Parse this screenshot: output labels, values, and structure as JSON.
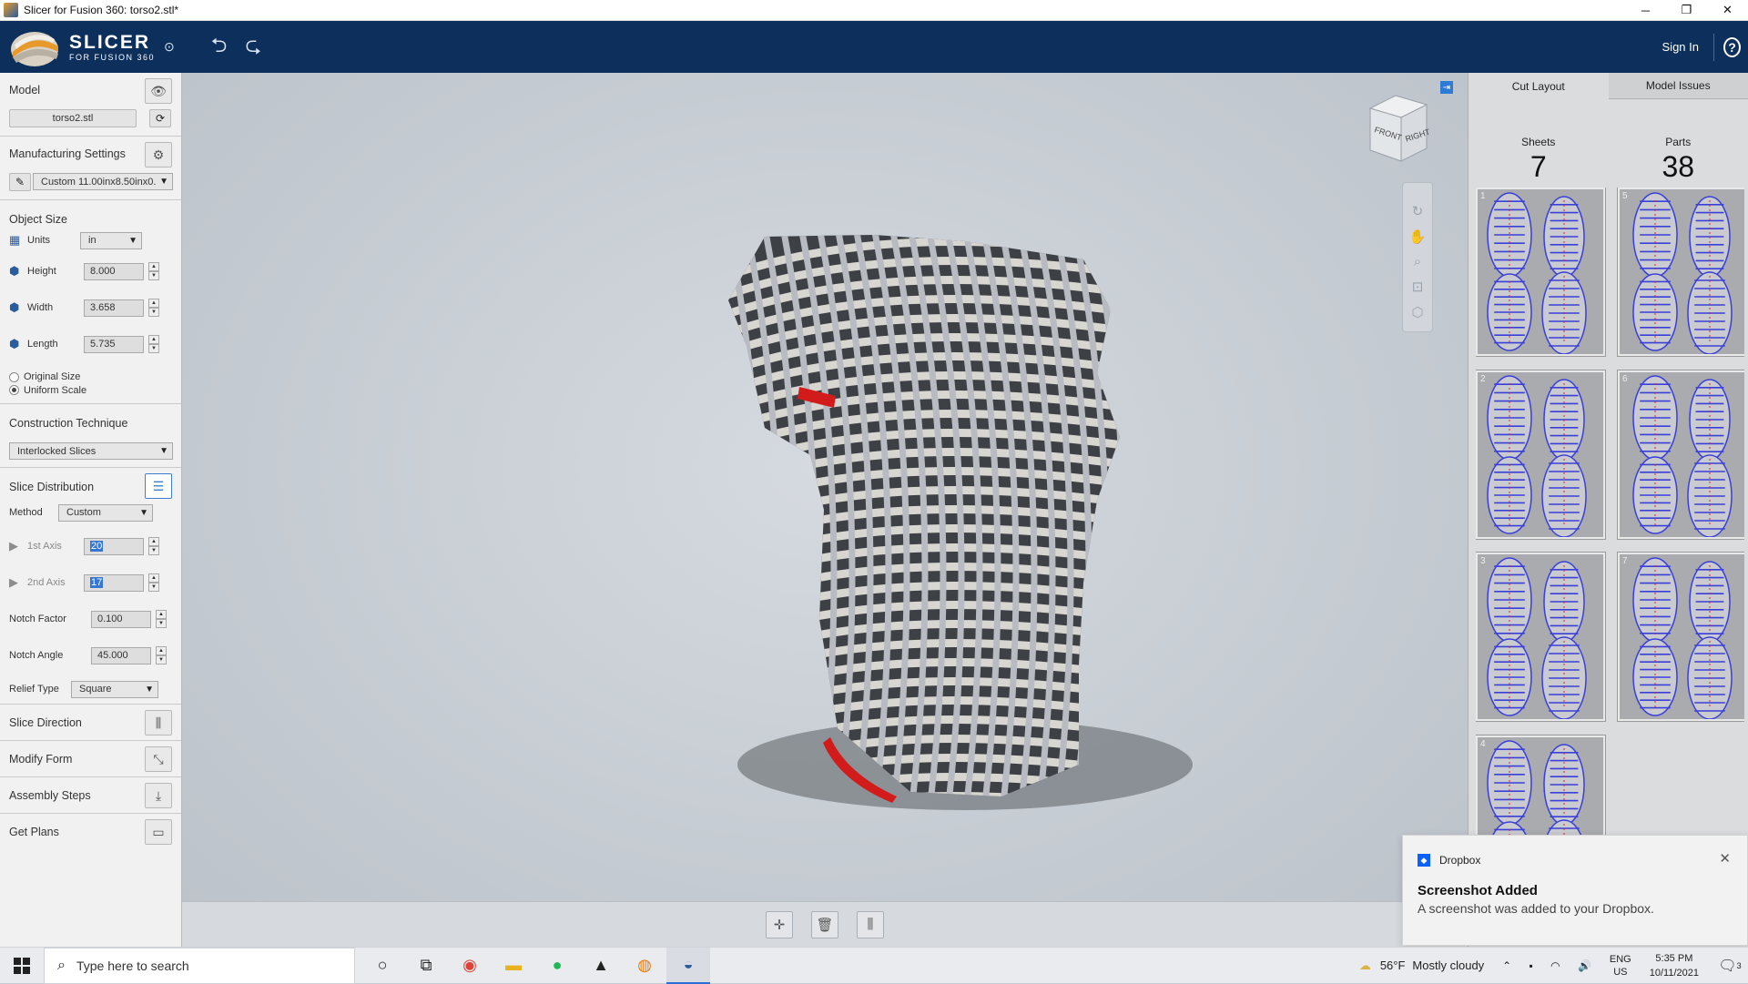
{
  "window": {
    "title": "Slicer for Fusion 360: torso2.stl*",
    "minimize": "─",
    "maximize": "❐",
    "close": "✕"
  },
  "header": {
    "logo_main": "SLICER",
    "logo_sub": "FOR FUSION 360",
    "sign_in": "Sign In",
    "help": "?"
  },
  "model": {
    "title": "Model",
    "file": "torso2.stl"
  },
  "manufacturing": {
    "title": "Manufacturing Settings",
    "preset": "Custom 11.00inx8.50inx0."
  },
  "object_size": {
    "title": "Object Size",
    "units_label": "Units",
    "units_value": "in",
    "height_label": "Height",
    "height_value": "8.000",
    "width_label": "Width",
    "width_value": "3.658",
    "length_label": "Length",
    "length_value": "5.735",
    "original_size": "Original Size",
    "uniform_scale": "Uniform Scale"
  },
  "construction": {
    "title": "Construction Technique",
    "value": "Interlocked Slices"
  },
  "slice_distribution": {
    "title": "Slice Distribution",
    "method_label": "Method",
    "method_value": "Custom",
    "axis1_label": "1st Axis",
    "axis1_value": "20",
    "axis2_label": "2nd Axis",
    "axis2_value": "17",
    "notch_factor_label": "Notch Factor",
    "notch_factor_value": "0.100",
    "notch_angle_label": "Notch Angle",
    "notch_angle_value": "45.000",
    "relief_label": "Relief Type",
    "relief_value": "Square"
  },
  "sections": {
    "slice_direction": "Slice Direction",
    "modify_form": "Modify Form",
    "assembly_steps": "Assembly Steps",
    "get_plans": "Get Plans"
  },
  "view_cube": {
    "front": "FRONT",
    "right": "RIGHT"
  },
  "right_panel": {
    "tab_cut_layout": "Cut Layout",
    "tab_model_issues": "Model Issues",
    "sheets_label": "Sheets",
    "sheets_value": "7",
    "parts_label": "Parts",
    "parts_value": "38",
    "sheet_numbers": [
      "1",
      "5",
      "2",
      "6",
      "3",
      "7",
      "4"
    ]
  },
  "toast": {
    "app": "Dropbox",
    "title": "Screenshot Added",
    "body": "A screenshot was added to your Dropbox."
  },
  "taskbar": {
    "search_placeholder": "Type here to search",
    "temperature": "56°F",
    "weather": "Mostly cloudy",
    "lang1": "ENG",
    "lang2": "US",
    "time": "5:35 PM",
    "date": "10/11/2021",
    "notifications": "3"
  },
  "colors": {
    "header_bg": "#0d2f5b",
    "accent": "#2e7bd6",
    "part_outline": "#3a3fd8",
    "part_label": "#e0202a"
  }
}
